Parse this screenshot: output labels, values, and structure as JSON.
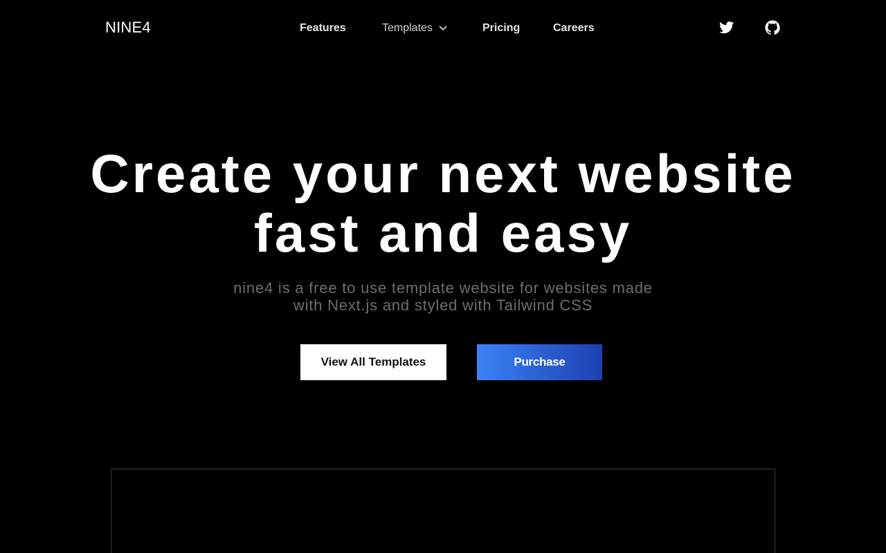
{
  "header": {
    "logo": "NINE4",
    "nav": {
      "features": "Features",
      "templates": "Templates",
      "pricing": "Pricing",
      "careers": "Careers"
    },
    "icons": {
      "templates_dropdown": "chevron-down-icon",
      "twitter": "twitter-icon",
      "github": "github-icon"
    }
  },
  "hero": {
    "title_line1": "Create your next website",
    "title_line2": "fast and easy",
    "subtitle_line1": "nine4 is a free to use template website for websites made",
    "subtitle_line2": "with Next.js and styled with Tailwind CSS",
    "buttons": {
      "view_all": "View All Templates",
      "purchase": "Purchase"
    }
  },
  "colors": {
    "background": "#000000",
    "accent_start": "#3b82f6",
    "accent_end": "#1e40af",
    "subtitle": "#6e6e6e"
  }
}
